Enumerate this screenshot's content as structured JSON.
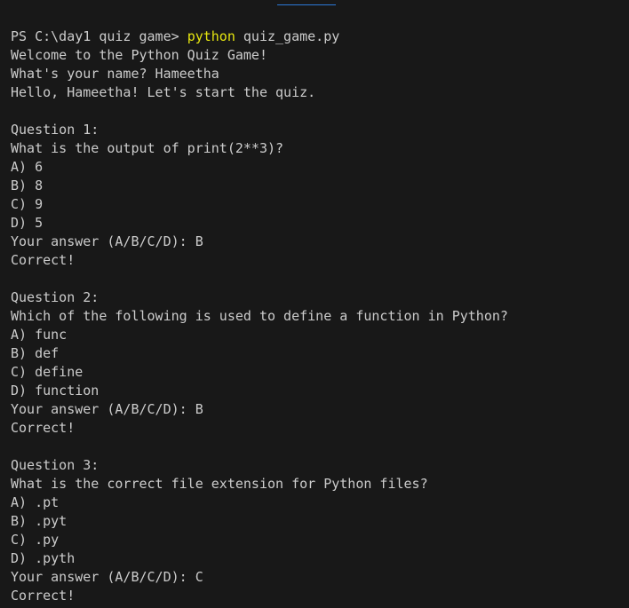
{
  "terminal": {
    "prompt": "PS C:\\day1 quiz game> ",
    "command": "python",
    "command_arg": " quiz_game.py",
    "colors": {
      "background": "#181818",
      "text": "#cccccc",
      "command": "#e5e510",
      "tab_indicator": "#2b79d8"
    },
    "output": [
      "Welcome to the Python Quiz Game!",
      "What's your name? Hameetha",
      "Hello, Hameetha! Let's start the quiz.",
      "",
      "Question 1:",
      "What is the output of print(2**3)?",
      "A) 6",
      "B) 8",
      "C) 9",
      "D) 5",
      "Your answer (A/B/C/D): B",
      "Correct!",
      "",
      "Question 2:",
      "Which of the following is used to define a function in Python?",
      "A) func",
      "B) def",
      "C) define",
      "D) function",
      "Your answer (A/B/C/D): B",
      "Correct!",
      "",
      "Question 3:",
      "What is the correct file extension for Python files?",
      "A) .pt",
      "B) .pyt",
      "C) .py",
      "D) .pyth",
      "Your answer (A/B/C/D): C",
      "Correct!"
    ]
  }
}
